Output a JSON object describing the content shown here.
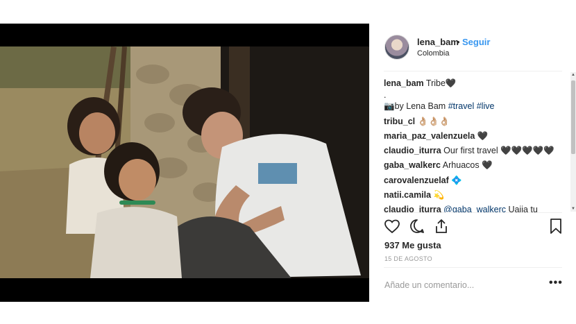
{
  "post": {
    "username": "lena_bam",
    "separator": "•",
    "follow_label": "Seguir",
    "location": "Colombia",
    "likes": "937 Me gusta",
    "date": "15 DE AGOSTO",
    "add_comment_placeholder": "Añade un comentario...",
    "more_label": "•••"
  },
  "caption": {
    "user": "lena_bam",
    "text": "Tribe🖤",
    "dot_line": ".",
    "credit_prefix": "📷by Lena Bam ",
    "hashtag_travel": "#travel",
    "hashtag_live": "#live"
  },
  "comments": [
    {
      "user": "tribu_cl",
      "text": "👌🏼👌🏼👌🏼"
    },
    {
      "user": "maria_paz_valenzuela",
      "text": "🖤"
    },
    {
      "user": "claudio_iturra",
      "text": "Our first travel 🖤🖤🖤🖤🖤"
    },
    {
      "user": "gaba_walkerc",
      "text": "Arhuacos 🖤"
    },
    {
      "user": "carovalenzuelaf",
      "text": "💠"
    },
    {
      "user": "natii.camila",
      "text": "💫"
    },
    {
      "user": "claudio_iturra",
      "text": "@gaba_walkerc Uajia tu"
    }
  ],
  "icons": {
    "like": "heart-icon",
    "comment": "comment-icon",
    "share": "share-icon",
    "save": "bookmark-icon",
    "more": "more-options-icon"
  },
  "colors": {
    "link_blue": "#3897f0",
    "hashtag": "#003569",
    "muted": "#999999",
    "text": "#262626"
  }
}
